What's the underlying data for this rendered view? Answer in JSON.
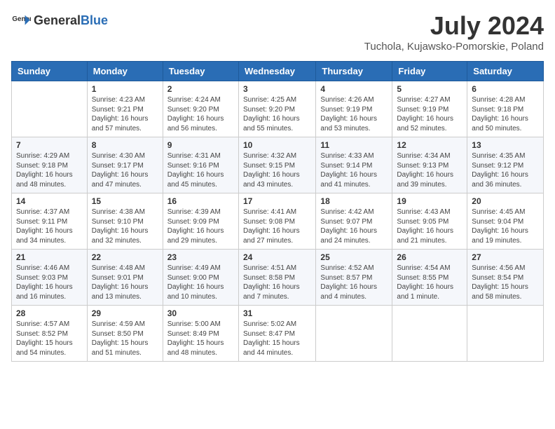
{
  "header": {
    "logo_general": "General",
    "logo_blue": "Blue",
    "main_title": "July 2024",
    "subtitle": "Tuchola, Kujawsko-Pomorskie, Poland"
  },
  "weekdays": [
    "Sunday",
    "Monday",
    "Tuesday",
    "Wednesday",
    "Thursday",
    "Friday",
    "Saturday"
  ],
  "weeks": [
    [
      {
        "day": "",
        "info": ""
      },
      {
        "day": "1",
        "info": "Sunrise: 4:23 AM\nSunset: 9:21 PM\nDaylight: 16 hours and 57 minutes."
      },
      {
        "day": "2",
        "info": "Sunrise: 4:24 AM\nSunset: 9:20 PM\nDaylight: 16 hours and 56 minutes."
      },
      {
        "day": "3",
        "info": "Sunrise: 4:25 AM\nSunset: 9:20 PM\nDaylight: 16 hours and 55 minutes."
      },
      {
        "day": "4",
        "info": "Sunrise: 4:26 AM\nSunset: 9:19 PM\nDaylight: 16 hours and 53 minutes."
      },
      {
        "day": "5",
        "info": "Sunrise: 4:27 AM\nSunset: 9:19 PM\nDaylight: 16 hours and 52 minutes."
      },
      {
        "day": "6",
        "info": "Sunrise: 4:28 AM\nSunset: 9:18 PM\nDaylight: 16 hours and 50 minutes."
      }
    ],
    [
      {
        "day": "7",
        "info": "Sunrise: 4:29 AM\nSunset: 9:18 PM\nDaylight: 16 hours and 48 minutes."
      },
      {
        "day": "8",
        "info": "Sunrise: 4:30 AM\nSunset: 9:17 PM\nDaylight: 16 hours and 47 minutes."
      },
      {
        "day": "9",
        "info": "Sunrise: 4:31 AM\nSunset: 9:16 PM\nDaylight: 16 hours and 45 minutes."
      },
      {
        "day": "10",
        "info": "Sunrise: 4:32 AM\nSunset: 9:15 PM\nDaylight: 16 hours and 43 minutes."
      },
      {
        "day": "11",
        "info": "Sunrise: 4:33 AM\nSunset: 9:14 PM\nDaylight: 16 hours and 41 minutes."
      },
      {
        "day": "12",
        "info": "Sunrise: 4:34 AM\nSunset: 9:13 PM\nDaylight: 16 hours and 39 minutes."
      },
      {
        "day": "13",
        "info": "Sunrise: 4:35 AM\nSunset: 9:12 PM\nDaylight: 16 hours and 36 minutes."
      }
    ],
    [
      {
        "day": "14",
        "info": "Sunrise: 4:37 AM\nSunset: 9:11 PM\nDaylight: 16 hours and 34 minutes."
      },
      {
        "day": "15",
        "info": "Sunrise: 4:38 AM\nSunset: 9:10 PM\nDaylight: 16 hours and 32 minutes."
      },
      {
        "day": "16",
        "info": "Sunrise: 4:39 AM\nSunset: 9:09 PM\nDaylight: 16 hours and 29 minutes."
      },
      {
        "day": "17",
        "info": "Sunrise: 4:41 AM\nSunset: 9:08 PM\nDaylight: 16 hours and 27 minutes."
      },
      {
        "day": "18",
        "info": "Sunrise: 4:42 AM\nSunset: 9:07 PM\nDaylight: 16 hours and 24 minutes."
      },
      {
        "day": "19",
        "info": "Sunrise: 4:43 AM\nSunset: 9:05 PM\nDaylight: 16 hours and 21 minutes."
      },
      {
        "day": "20",
        "info": "Sunrise: 4:45 AM\nSunset: 9:04 PM\nDaylight: 16 hours and 19 minutes."
      }
    ],
    [
      {
        "day": "21",
        "info": "Sunrise: 4:46 AM\nSunset: 9:03 PM\nDaylight: 16 hours and 16 minutes."
      },
      {
        "day": "22",
        "info": "Sunrise: 4:48 AM\nSunset: 9:01 PM\nDaylight: 16 hours and 13 minutes."
      },
      {
        "day": "23",
        "info": "Sunrise: 4:49 AM\nSunset: 9:00 PM\nDaylight: 16 hours and 10 minutes."
      },
      {
        "day": "24",
        "info": "Sunrise: 4:51 AM\nSunset: 8:58 PM\nDaylight: 16 hours and 7 minutes."
      },
      {
        "day": "25",
        "info": "Sunrise: 4:52 AM\nSunset: 8:57 PM\nDaylight: 16 hours and 4 minutes."
      },
      {
        "day": "26",
        "info": "Sunrise: 4:54 AM\nSunset: 8:55 PM\nDaylight: 16 hours and 1 minute."
      },
      {
        "day": "27",
        "info": "Sunrise: 4:56 AM\nSunset: 8:54 PM\nDaylight: 15 hours and 58 minutes."
      }
    ],
    [
      {
        "day": "28",
        "info": "Sunrise: 4:57 AM\nSunset: 8:52 PM\nDaylight: 15 hours and 54 minutes."
      },
      {
        "day": "29",
        "info": "Sunrise: 4:59 AM\nSunset: 8:50 PM\nDaylight: 15 hours and 51 minutes."
      },
      {
        "day": "30",
        "info": "Sunrise: 5:00 AM\nSunset: 8:49 PM\nDaylight: 15 hours and 48 minutes."
      },
      {
        "day": "31",
        "info": "Sunrise: 5:02 AM\nSunset: 8:47 PM\nDaylight: 15 hours and 44 minutes."
      },
      {
        "day": "",
        "info": ""
      },
      {
        "day": "",
        "info": ""
      },
      {
        "day": "",
        "info": ""
      }
    ]
  ]
}
